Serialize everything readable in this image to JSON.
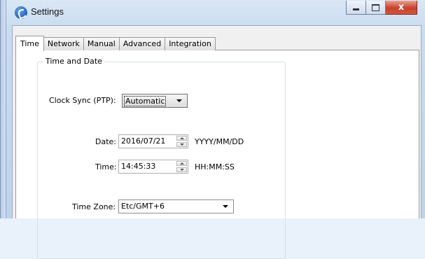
{
  "window": {
    "title": "Settings",
    "controls": {
      "minimize": "minimize",
      "maximize": "maximize",
      "close": "x"
    }
  },
  "tabs": [
    {
      "label": "Time",
      "active": true
    },
    {
      "label": "Network",
      "active": false
    },
    {
      "label": "Manual",
      "active": false
    },
    {
      "label": "Advanced",
      "active": false
    },
    {
      "label": "Integration",
      "active": false
    }
  ],
  "time_and_date": {
    "group_title": "Time and Date",
    "clock_sync": {
      "label": "Clock Sync (PTP):",
      "value": "Automatic"
    },
    "date": {
      "label": "Date:",
      "value": "2016/07/21",
      "format": "YYYY/MM/DD"
    },
    "time": {
      "label": "Time:",
      "value": "14:45:33",
      "format": "HH:MM:SS"
    },
    "time_zone": {
      "label": "Time Zone:",
      "value": "Etc/GMT+6"
    }
  },
  "icons": {
    "app": "settings-app-icon",
    "dropdown": "chevron-down-icon",
    "spin_up": "spin-up-icon",
    "spin_down": "spin-down-icon"
  },
  "colors": {
    "titlebar": "#dae7f5",
    "close_button": "#c7402d",
    "panel": "#ffffff",
    "client": "#f0f0f0"
  }
}
